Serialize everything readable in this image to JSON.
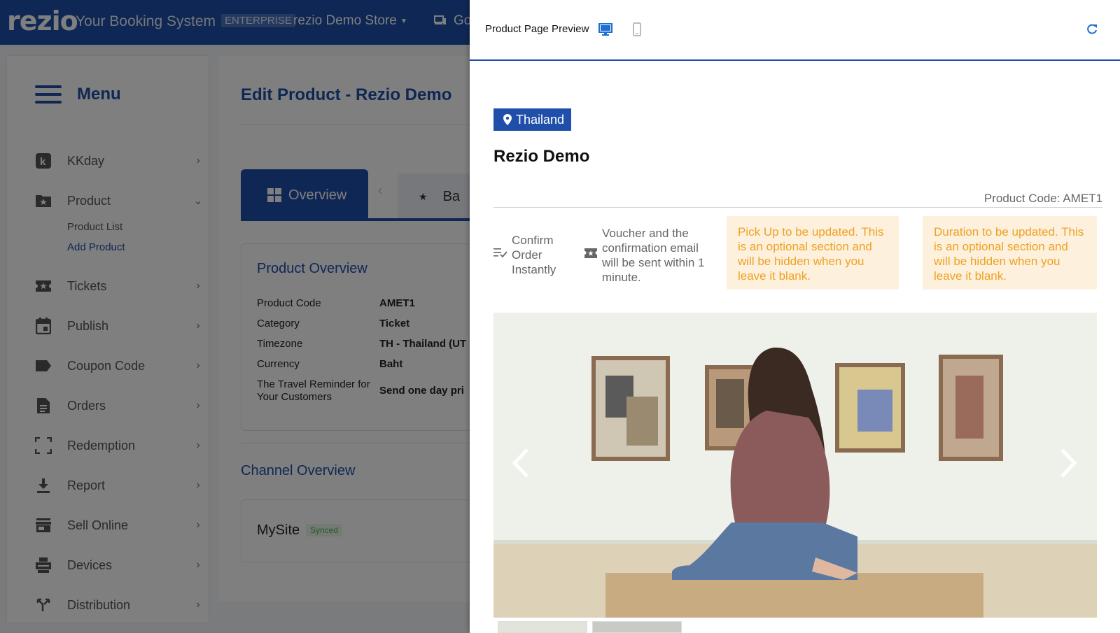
{
  "topbar": {
    "logo": "rezio",
    "subtitle": "Your Booking System",
    "plan_badge": "ENTERPRISE",
    "store_name": "rezio Demo Store",
    "go_label": "Go"
  },
  "sidebar": {
    "title": "Menu",
    "items": [
      {
        "label": "KKday",
        "icon": "kkday-icon"
      },
      {
        "label": "Product",
        "icon": "folder-star-icon"
      },
      {
        "label": "Tickets",
        "icon": "ticket-icon"
      },
      {
        "label": "Publish",
        "icon": "calendar-icon"
      },
      {
        "label": "Coupon Code",
        "icon": "tag-icon"
      },
      {
        "label": "Orders",
        "icon": "document-icon"
      },
      {
        "label": "Redemption",
        "icon": "scan-icon"
      },
      {
        "label": "Report",
        "icon": "download-icon"
      },
      {
        "label": "Sell Online",
        "icon": "store-icon"
      },
      {
        "label": "Devices",
        "icon": "printer-icon"
      },
      {
        "label": "Distribution",
        "icon": "distribution-icon"
      }
    ],
    "product_sub": [
      "Product List",
      "Add Product"
    ]
  },
  "main": {
    "page_title": "Edit Product  - Rezio Demo",
    "tabs": [
      "Overview",
      "Ba"
    ],
    "product_overview": {
      "title": "Product Overview",
      "rows": [
        {
          "key": "Product Code",
          "value": "AMET1"
        },
        {
          "key": "Category",
          "value": "Ticket"
        },
        {
          "key": "Timezone",
          "value": "TH - Thailand (UT"
        },
        {
          "key": "Currency",
          "value": "Baht"
        },
        {
          "key": "The Travel Reminder for Your Customers",
          "value": "Send one day pri"
        }
      ]
    },
    "channel_overview": {
      "title": "Channel Overview",
      "channel_name": "MySite",
      "channel_status": "Synced"
    }
  },
  "preview": {
    "header_title": "Product Page Preview",
    "location": "Thailand",
    "product_title": "Rezio Demo",
    "product_code": "Product Code: AMET1",
    "feature_confirm": "Confirm Order Instantly",
    "feature_voucher": "Voucher and the confirmation email will be sent within 1 minute.",
    "note_pickup": "Pick Up to be updated. This is an optional section and will be hidden when you leave it blank.",
    "note_duration": "Duration to be updated. This is an optional section and will be hidden when you leave it blank."
  },
  "colors": {
    "brand": "#1f4fa8",
    "note_bg": "#fdf1de",
    "note_text": "#f0a020",
    "synced": "#4caf50"
  }
}
